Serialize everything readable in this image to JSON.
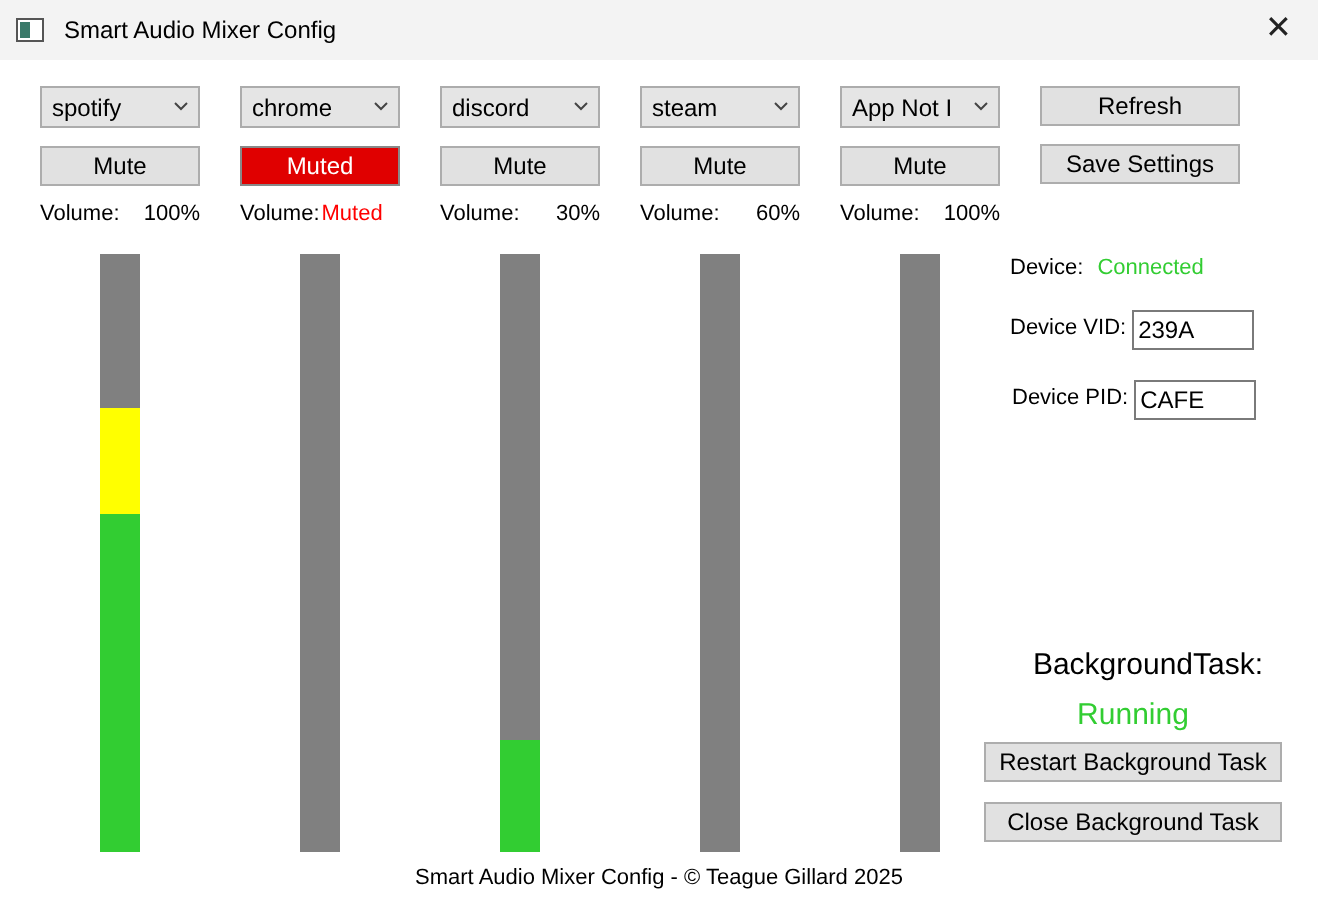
{
  "window": {
    "title": "Smart Audio Mixer Config",
    "close": "✕"
  },
  "channels": [
    {
      "app": "spotify",
      "mute_label": "Mute",
      "muted": false,
      "volume_label": "Volume:",
      "volume": "100%"
    },
    {
      "app": "chrome",
      "mute_label": "Muted",
      "muted": true,
      "volume_label": "Volume:",
      "volume": "Muted"
    },
    {
      "app": "discord",
      "mute_label": "Mute",
      "muted": false,
      "volume_label": "Volume:",
      "volume": "30%"
    },
    {
      "app": "steam",
      "mute_label": "Mute",
      "muted": false,
      "volume_label": "Volume:",
      "volume": "60%"
    },
    {
      "app": "App Not I",
      "mute_label": "Mute",
      "muted": false,
      "volume_label": "Volume:",
      "volume": "100%"
    }
  ],
  "buttons": [
    "Refresh",
    "Save Settings"
  ],
  "device": {
    "label": "Device:",
    "status": "Connected",
    "vid_label": "Device VID:",
    "vid": "239A",
    "pid_label": "Device PID:",
    "pid": "CAFE"
  },
  "background_task": {
    "label": "BackgroundTask:",
    "status": "Running",
    "buttons": [
      "Restart Background Task",
      "Close Background Task"
    ]
  },
  "footer": "Smart Audio Mixer Config - © Teague Gillard 2025"
}
